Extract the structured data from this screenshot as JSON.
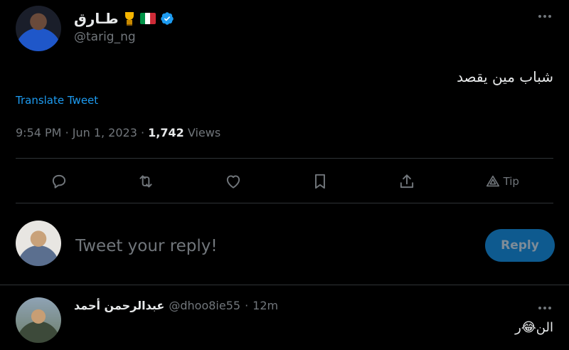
{
  "tweet": {
    "author": {
      "display_name": "طـارق",
      "handle": "@tarig_ng",
      "flag_colors": [
        "#009246",
        "#ffffff",
        "#ce2b37"
      ],
      "verified_color": "#1d9bf0"
    },
    "text": "شباب مين يقصد",
    "translate_label": "Translate Tweet",
    "time": "9:54 PM",
    "date": "Jun 1, 2023",
    "views_count": "1,742",
    "views_label": "Views"
  },
  "actions": {
    "icons": [
      "reply-icon",
      "retweet-icon",
      "like-icon",
      "bookmark-icon",
      "share-icon",
      "tip-icon"
    ],
    "tip_label": "Tip"
  },
  "reply_composer": {
    "placeholder": "Tweet your reply!",
    "button_label": "Reply",
    "button_color": "#0e5a8f"
  },
  "replies": [
    {
      "display_name": "عبدالرحمن أحمد",
      "handle": "@dhoo8ie55",
      "separator": "·",
      "time": "12m",
      "text": "الن😂ر"
    }
  ],
  "colors": {
    "background": "#000000",
    "primary_text": "#e7e9ea",
    "secondary_text": "#71767b",
    "link": "#1d9bf0",
    "divider": "#2f3336"
  }
}
